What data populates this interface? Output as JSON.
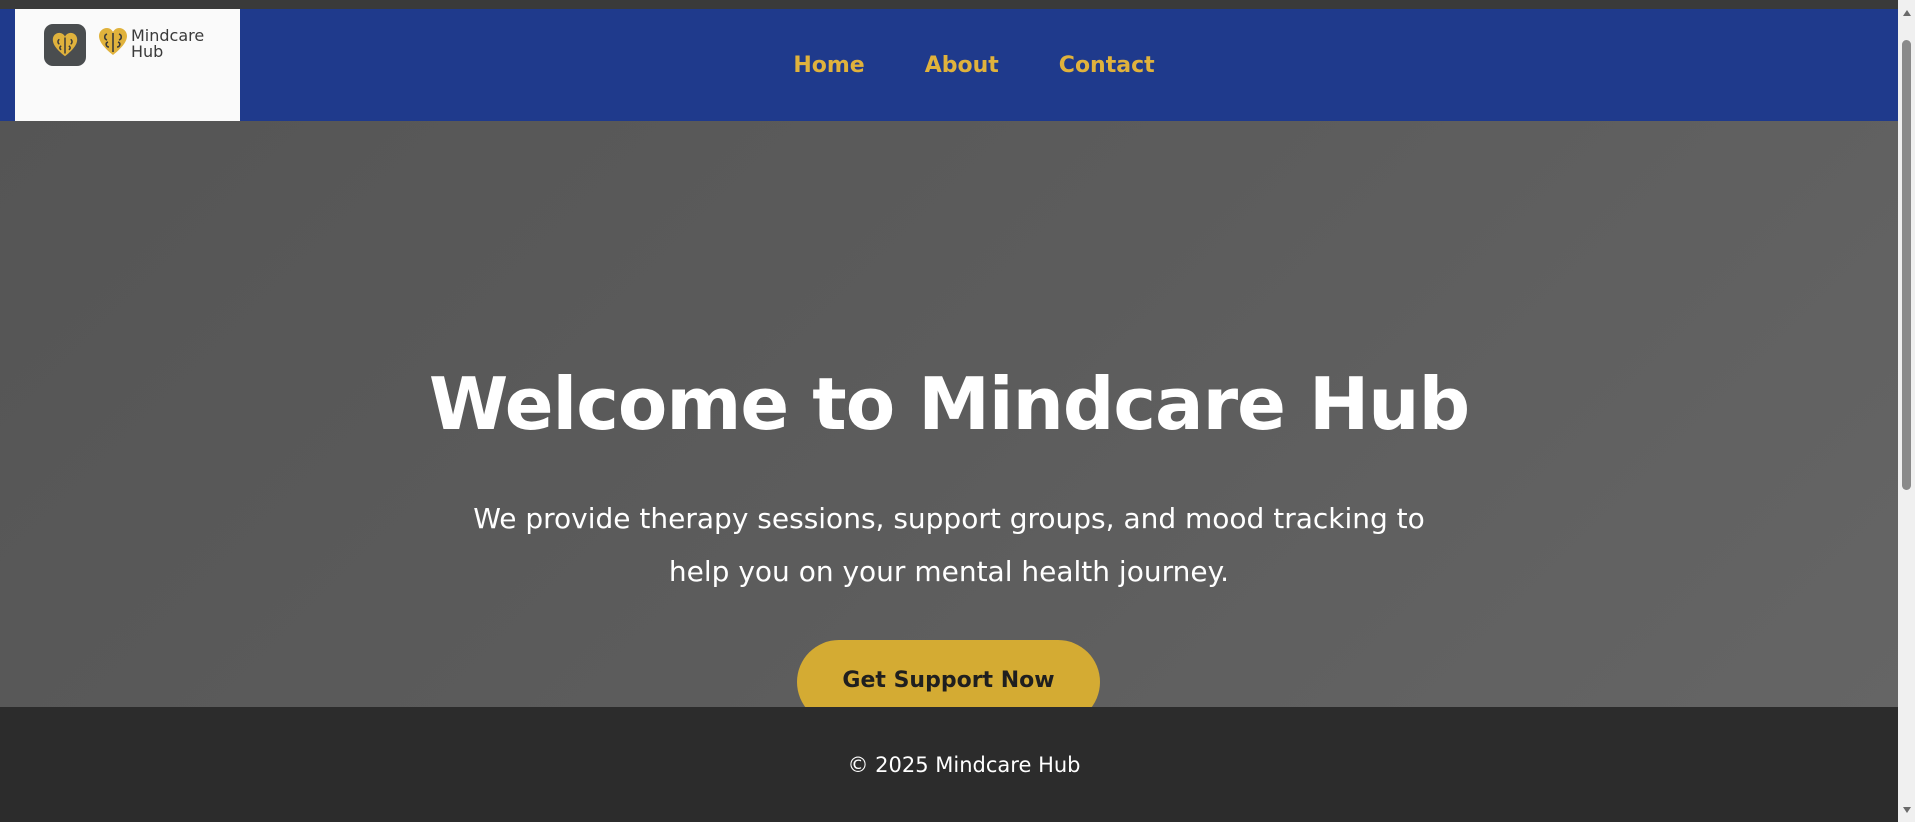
{
  "brand": {
    "name_line1": "Mindcare",
    "name_line2": "Hub",
    "logo_icon": "brain-heart-icon",
    "colors": {
      "navy": "#1f3a8c",
      "gold": "#e0b23c",
      "cta": "#d4ab33"
    }
  },
  "nav": {
    "items": [
      {
        "label": "Home"
      },
      {
        "label": "About"
      },
      {
        "label": "Contact"
      }
    ]
  },
  "hero": {
    "title": "Welcome to Mindcare Hub",
    "subtitle": "We provide therapy sessions, support groups, and mood tracking to help you on your mental health journey.",
    "cta_label": "Get Support Now"
  },
  "footer": {
    "text": "© 2025 Mindcare Hub"
  }
}
